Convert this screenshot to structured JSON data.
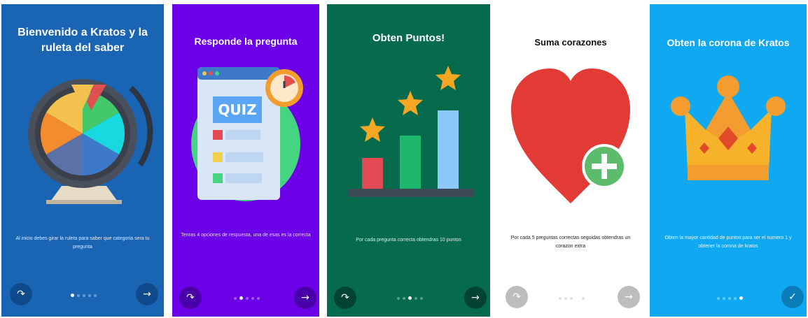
{
  "screens": [
    {
      "title": "Bienvenido a Kratos y la ruleta del saber",
      "description": "Al inicio debes girar la ruleta para saber que categoria sera tu pregunta",
      "background": "#1A64B4",
      "active_dot": 0,
      "action_icon": "arrow-right-icon"
    },
    {
      "title": "Responde la pregunta",
      "description": "Tenras 4 opciones de respuesta, una de esas es la correcta",
      "quiz_label": "QUIZ",
      "background": "#6C00E6",
      "active_dot": 1,
      "action_icon": "arrow-right-icon"
    },
    {
      "title": "Obten Puntos!",
      "description": "Por cada pregunta correcta obtendras 10 puntos",
      "background": "#066A4C",
      "active_dot": 2,
      "action_icon": "arrow-right-icon"
    },
    {
      "title": "Suma corazones",
      "description": "Por cada 5 preguntas correctas seguidas obtendras un corazon extra",
      "background": "#FFFFFF",
      "active_dot": 3,
      "action_icon": "arrow-right-icon"
    },
    {
      "title": "Obten la corona de Kratos",
      "description": "Obten la mayor cantidad de puntos para ser el numero 1 y obtener la corona de kratos",
      "background": "#10A8F0",
      "active_dot": 4,
      "action_icon": "check-icon"
    }
  ],
  "icons": {
    "skip": "skip-arrow-icon",
    "next": "arrow-right-icon",
    "done": "check-icon"
  }
}
